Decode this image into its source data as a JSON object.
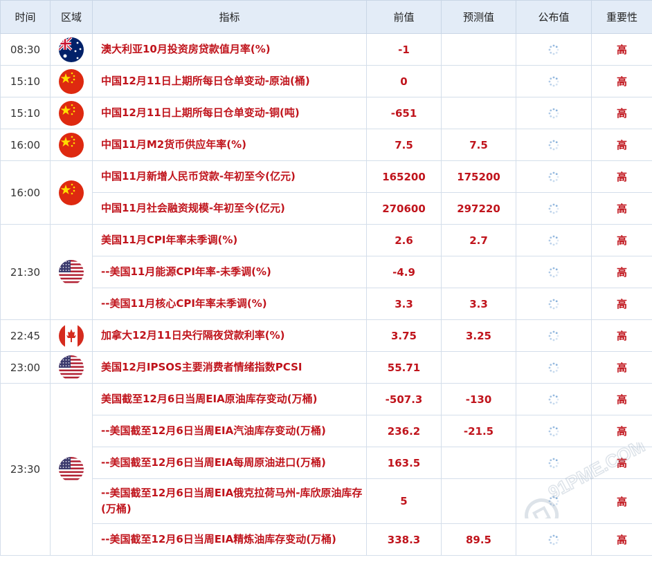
{
  "headers": {
    "time": "时间",
    "region": "区域",
    "indicator": "指标",
    "previous": "前值",
    "forecast": "预测值",
    "actual": "公布值",
    "importance": "重要性"
  },
  "rows": [
    {
      "time": "08:30",
      "country": "australia-flag-icon",
      "indicator": "澳大利亚10月投资房贷款值月率(%)",
      "previous": "-1",
      "forecast": "",
      "importance": "高"
    },
    {
      "time": "15:10",
      "country": "china-flag-icon",
      "indicator": "中国12月11日上期所每日仓单变动-原油(桶)",
      "previous": "0",
      "forecast": "",
      "importance": "高"
    },
    {
      "time": "15:10",
      "country": "china-flag-icon",
      "indicator": "中国12月11日上期所每日仓单变动-铜(吨)",
      "previous": "-651",
      "forecast": "",
      "importance": "高"
    },
    {
      "time": "16:00",
      "country": "china-flag-icon",
      "indicator": "中国11月M2货币供应年率(%)",
      "previous": "7.5",
      "forecast": "7.5",
      "importance": "高"
    },
    {
      "time": "16:00",
      "country": "china-flag-icon",
      "indicator": "中国11月新增人民币贷款-年初至今(亿元)",
      "previous": "165200",
      "forecast": "175200",
      "importance": "高"
    },
    {
      "time": "",
      "country": "",
      "indicator": "中国11月社会融资规模-年初至今(亿元)",
      "previous": "270600",
      "forecast": "297220",
      "importance": "高"
    },
    {
      "time": "21:30",
      "country": "usa-flag-icon",
      "indicator": "美国11月CPI年率未季调(%)",
      "previous": "2.6",
      "forecast": "2.7",
      "importance": "高"
    },
    {
      "time": "",
      "country": "",
      "indicator": "--美国11月能源CPI年率-未季调(%)",
      "previous": "-4.9",
      "forecast": "",
      "importance": "高"
    },
    {
      "time": "",
      "country": "",
      "indicator": "--美国11月核心CPI年率未季调(%)",
      "previous": "3.3",
      "forecast": "3.3",
      "importance": "高"
    },
    {
      "time": "22:45",
      "country": "canada-flag-icon",
      "indicator": "加拿大12月11日央行隔夜贷款利率(%)",
      "previous": "3.75",
      "forecast": "3.25",
      "importance": "高"
    },
    {
      "time": "23:00",
      "country": "usa-flag-icon",
      "indicator": "美国12月IPSOS主要消费者情绪指数PCSI",
      "previous": "55.71",
      "forecast": "",
      "importance": "高"
    },
    {
      "time": "23:30",
      "country": "usa-flag-icon",
      "indicator": "美国截至12月6日当周EIA原油库存变动(万桶)",
      "previous": "-507.3",
      "forecast": "-130",
      "importance": "高"
    },
    {
      "time": "",
      "country": "",
      "indicator": "--美国截至12月6日当周EIA汽油库存变动(万桶)",
      "previous": "236.2",
      "forecast": "-21.5",
      "importance": "高"
    },
    {
      "time": "",
      "country": "",
      "indicator": "--美国截至12月6日当周EIA每周原油进口(万桶)",
      "previous": "163.5",
      "forecast": "",
      "importance": "高"
    },
    {
      "time": "",
      "country": "",
      "indicator": "--美国截至12月6日当周EIA俄克拉荷马州-库欣原油库存(万桶)",
      "previous": "5",
      "forecast": "",
      "importance": "高"
    },
    {
      "time": "",
      "country": "",
      "indicator": "--美国截至12月6日当周EIA精炼油库存变动(万桶)",
      "previous": "338.3",
      "forecast": "89.5",
      "importance": "高"
    }
  ],
  "watermark": {
    "text": "91PME.COM",
    "icon": "watermark-logo-icon"
  },
  "colors": {
    "header_bg": "#e3ecf7",
    "value_red": "#c0141c",
    "border": "#d4deea",
    "spinner": "#7aa7d6"
  }
}
